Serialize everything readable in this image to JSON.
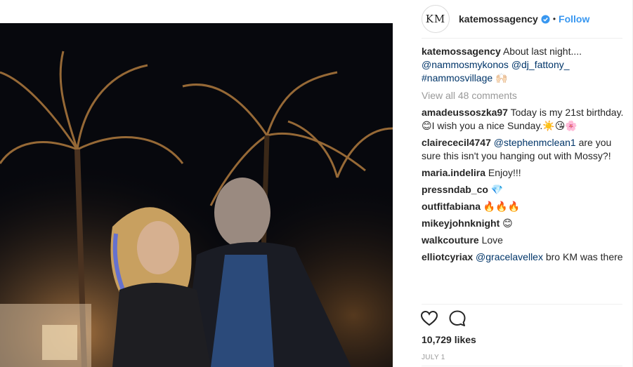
{
  "post": {
    "image_alt": "Night photo: woman with blonde hair and man in dark jacket under palm trees",
    "likes": "10,729 likes",
    "date": "JULY 1"
  },
  "header": {
    "avatar_text": "KM",
    "username": "katemossagency",
    "separator": "•",
    "follow_label": "Follow",
    "colors": {
      "follow": "#3897f0",
      "verified": "#3897f0"
    }
  },
  "caption": {
    "username": "katemossagency",
    "text": " About last night....",
    "mention1": "@nammosmykonos",
    "mention2": "@dj_fattony_",
    "hashtag": "#nammosvillage",
    "emoji": " 🙌🏻"
  },
  "view_all": "View all 48 comments",
  "comments": [
    {
      "user": "amadeussoszka97",
      "text": " Today is my 21st birthday.😊I wish you a nice Sunday.☀️😘🌸"
    },
    {
      "user": "clairececil4747",
      "mention": "@stephenmclean1",
      "text": " are you sure this isn't you hanging out with Mossy?!"
    },
    {
      "user": "maria.indelira",
      "text": " Enjoy!!!"
    },
    {
      "user": "pressndab_co",
      "text": " 💎"
    },
    {
      "user": "outfitfabiana",
      "text": " 🔥🔥🔥"
    },
    {
      "user": "mikeyjohnknight",
      "text": " 😊"
    },
    {
      "user": "walkcouture",
      "text": " Love"
    },
    {
      "user": "elliotcyriax",
      "mention": "@gracelavellex",
      "text": " bro KM was there"
    }
  ],
  "icons": [
    "heart-icon",
    "comment-icon",
    "verified-badge-icon"
  ]
}
